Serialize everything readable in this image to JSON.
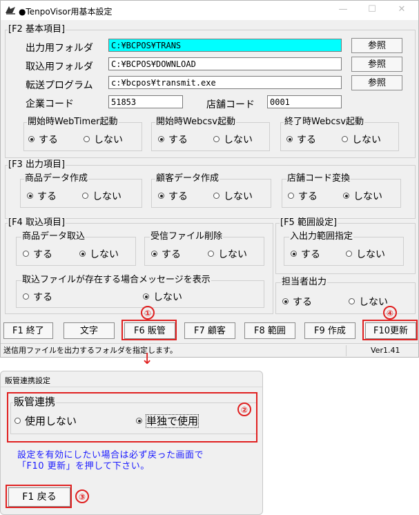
{
  "window": {
    "title": "●TenpoVisor用基本設定",
    "minimize": "—",
    "maximize": "☐",
    "close": "✕"
  },
  "f2": {
    "label": "[F2 基本項目]",
    "output_folder": {
      "label": "出力用フォルダ",
      "value": "C:¥BCPOS¥TRANS",
      "button": "参照"
    },
    "import_folder": {
      "label": "取込用フォルダ",
      "value": "C:¥BCPOS¥DOWNLOAD",
      "button": "参照"
    },
    "transfer_program": {
      "label": "転送プログラム",
      "value": "c:¥bcpos¥transmit.exe",
      "button": "参照"
    },
    "company_code": {
      "label": "企業コード",
      "value": "51853"
    },
    "store_code": {
      "label": "店舗コード",
      "value": "0001"
    },
    "webtimer": {
      "label": "開始時WebTimer起動",
      "opt1": "する",
      "opt2": "しない",
      "selected": "する"
    },
    "webcsv_start": {
      "label": "開始時Webcsv起動",
      "opt1": "する",
      "opt2": "しない",
      "selected": "する"
    },
    "webcsv_end": {
      "label": "終了時Webcsv起動",
      "opt1": "する",
      "opt2": "しない",
      "selected": "する"
    }
  },
  "f3": {
    "label": "[F3 出力項目]",
    "product": {
      "label": "商品データ作成",
      "opt1": "する",
      "opt2": "しない",
      "selected": "する"
    },
    "customer": {
      "label": "顧客データ作成",
      "opt1": "する",
      "opt2": "しない",
      "selected": "する"
    },
    "storecode_conv": {
      "label": "店舗コード変換",
      "opt1": "する",
      "opt2": "しない",
      "selected": "しない"
    }
  },
  "f4": {
    "label": "[F4 取込項目]",
    "product_import": {
      "label": "商品データ取込",
      "opt1": "する",
      "opt2": "しない",
      "selected": "しない"
    },
    "delete_received": {
      "label": "受信ファイル削除",
      "opt1": "する",
      "opt2": "しない",
      "selected": "する"
    },
    "exists_msg": {
      "label": "取込ファイルが存在する場合メッセージを表示",
      "opt1": "する",
      "opt2": "しない",
      "selected": "しない"
    }
  },
  "f5": {
    "label": "[F5 範囲設定]",
    "io_range": {
      "label": "入出力範囲指定",
      "opt1": "する",
      "opt2": "しない",
      "selected": "する"
    },
    "staff_output": {
      "label": "担当者出力",
      "opt1": "する",
      "opt2": "しない",
      "selected": "する"
    }
  },
  "fkeys": [
    "F1 終了",
    "文字",
    "F6 販管",
    "F7 顧客",
    "F8 範囲",
    "F9 作成",
    "F10更新"
  ],
  "status": {
    "message": "送信用ファイルを出力するフォルダを指定します。",
    "version": "Ver1.41"
  },
  "dialog": {
    "title": "販管連携設定",
    "group_label": "販管連携",
    "opt1": "使用しない",
    "opt2": "単独で使用",
    "selected": "単独で使用",
    "note1": "設定を有効にしたい場合は必ず戻った画面で",
    "note2": "「F10 更新」を押して下さい。",
    "back_button": "F1 戻る"
  },
  "badges": {
    "b1": "①",
    "b2": "②",
    "b3": "③",
    "b4": "④"
  },
  "arrow": "↓",
  "colors": {
    "highlight_field": "#00ffff",
    "annotation": "#e02020",
    "note_text": "#1a1aff"
  }
}
